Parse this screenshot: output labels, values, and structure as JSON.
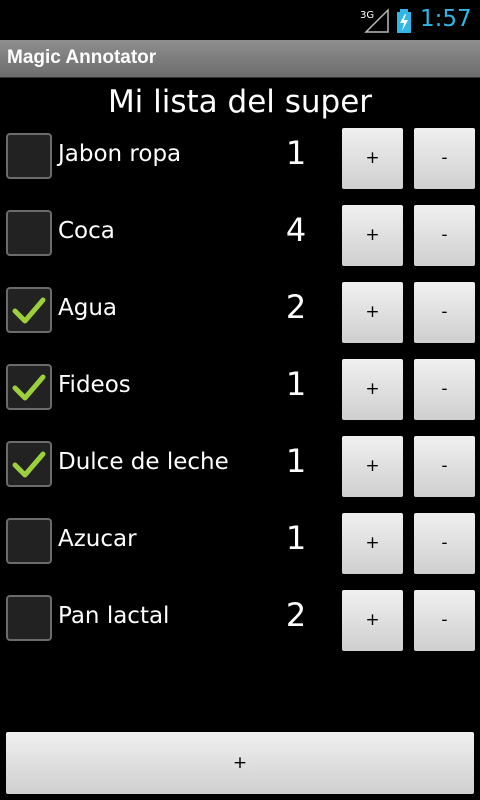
{
  "status_bar": {
    "network_label": "3G",
    "network_icon": "signal-icon",
    "battery_icon": "battery-charging-icon",
    "time": "1:57",
    "time_color": "#33b5e5"
  },
  "title_bar": {
    "title": "Magic Annotator"
  },
  "heading": "Mi lista del super",
  "items": [
    {
      "label": "Jabon ropa",
      "quantity": "1",
      "checked": false,
      "plus": "+",
      "minus": "-"
    },
    {
      "label": "Coca",
      "quantity": "4",
      "checked": false,
      "plus": "+",
      "minus": "-"
    },
    {
      "label": "Agua",
      "quantity": "2",
      "checked": true,
      "plus": "+",
      "minus": "-"
    },
    {
      "label": "Fideos",
      "quantity": "1",
      "checked": true,
      "plus": "+",
      "minus": "-"
    },
    {
      "label": "Dulce de leche",
      "quantity": "1",
      "checked": true,
      "plus": "+",
      "minus": "-"
    },
    {
      "label": "Azucar",
      "quantity": "1",
      "checked": false,
      "plus": "+",
      "minus": "-"
    },
    {
      "label": "Pan lactal",
      "quantity": "2",
      "checked": false,
      "plus": "+",
      "minus": "-"
    }
  ],
  "add_button_label": "+",
  "colors": {
    "check": "#9ccf3c",
    "accent": "#33b5e5"
  }
}
